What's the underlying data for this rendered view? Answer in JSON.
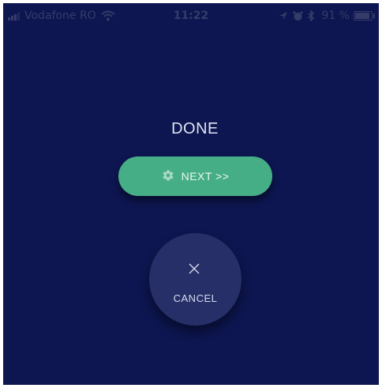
{
  "status_bar": {
    "carrier": "Vodafone RO",
    "time": "11:22",
    "battery_percent": "91 %",
    "battery_level": 0.91,
    "icons": [
      "signal-icon",
      "wifi-icon",
      "location-arrow-icon",
      "alarm-icon",
      "bluetooth-icon",
      "battery-icon"
    ]
  },
  "main": {
    "title": "DONE",
    "next_button": {
      "label": "NEXT >>",
      "icon": "gear-icon"
    },
    "cancel_button": {
      "label": "CANCEL",
      "icon": "close-icon"
    }
  },
  "colors": {
    "background": "#0d1650",
    "next_button": "#46ae86",
    "cancel_button": "#262f67",
    "status_bar_text": "#353c6a"
  }
}
